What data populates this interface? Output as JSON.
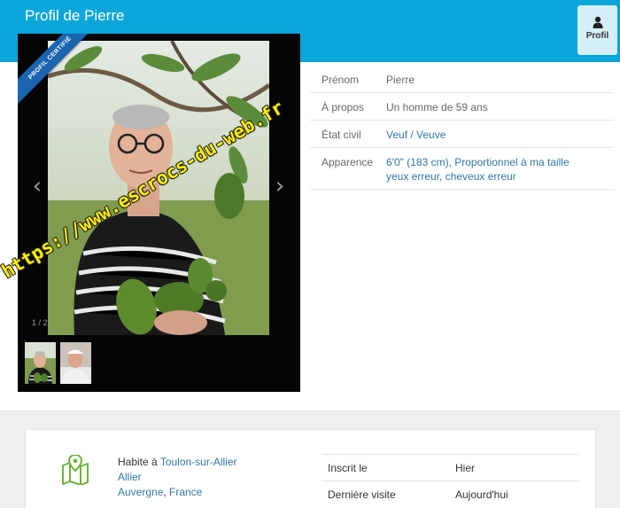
{
  "header": {
    "title": "Profil de Pierre",
    "profile_button_label": "Profil"
  },
  "gallery": {
    "badge": "PROFIL CERTIFIÉ",
    "watermark": "https://www.escrocs-du-web.fr",
    "counter": "1 / 2",
    "prev_glyph": "‹",
    "next_glyph": "›",
    "thumbnails": 2
  },
  "details": {
    "prenom": {
      "key": "Prénom",
      "value": "Pierre"
    },
    "apropos": {
      "key": "À propos",
      "value": "Un homme de 59 ans"
    },
    "etat_civil": {
      "key": "État civil",
      "value": "Veuf / Veuve"
    },
    "apparence": {
      "key": "Apparence",
      "line1": "6'0\" (183 cm), Proportionnel à ma taille",
      "line2": "yeux erreur, cheveux erreur"
    }
  },
  "location": {
    "prefix": "Habite à ",
    "city": "Toulon-sur-Allier",
    "department": "Allier",
    "region": "Auvergne",
    "separator": ", ",
    "country": "France"
  },
  "stats": {
    "inscrit": {
      "key": "Inscrit le",
      "value": "Hier"
    },
    "visite": {
      "key": "Dernière visite",
      "value": "Aujourd'hui"
    }
  },
  "colors": {
    "header": "#0aa6da",
    "link": "#2f78a8",
    "watermark": "#ffef00",
    "ribbon": "#1a64b0",
    "map_icon": "#6db33f"
  },
  "icons": {
    "profile": "user-icon",
    "location": "map-pin-icon"
  }
}
